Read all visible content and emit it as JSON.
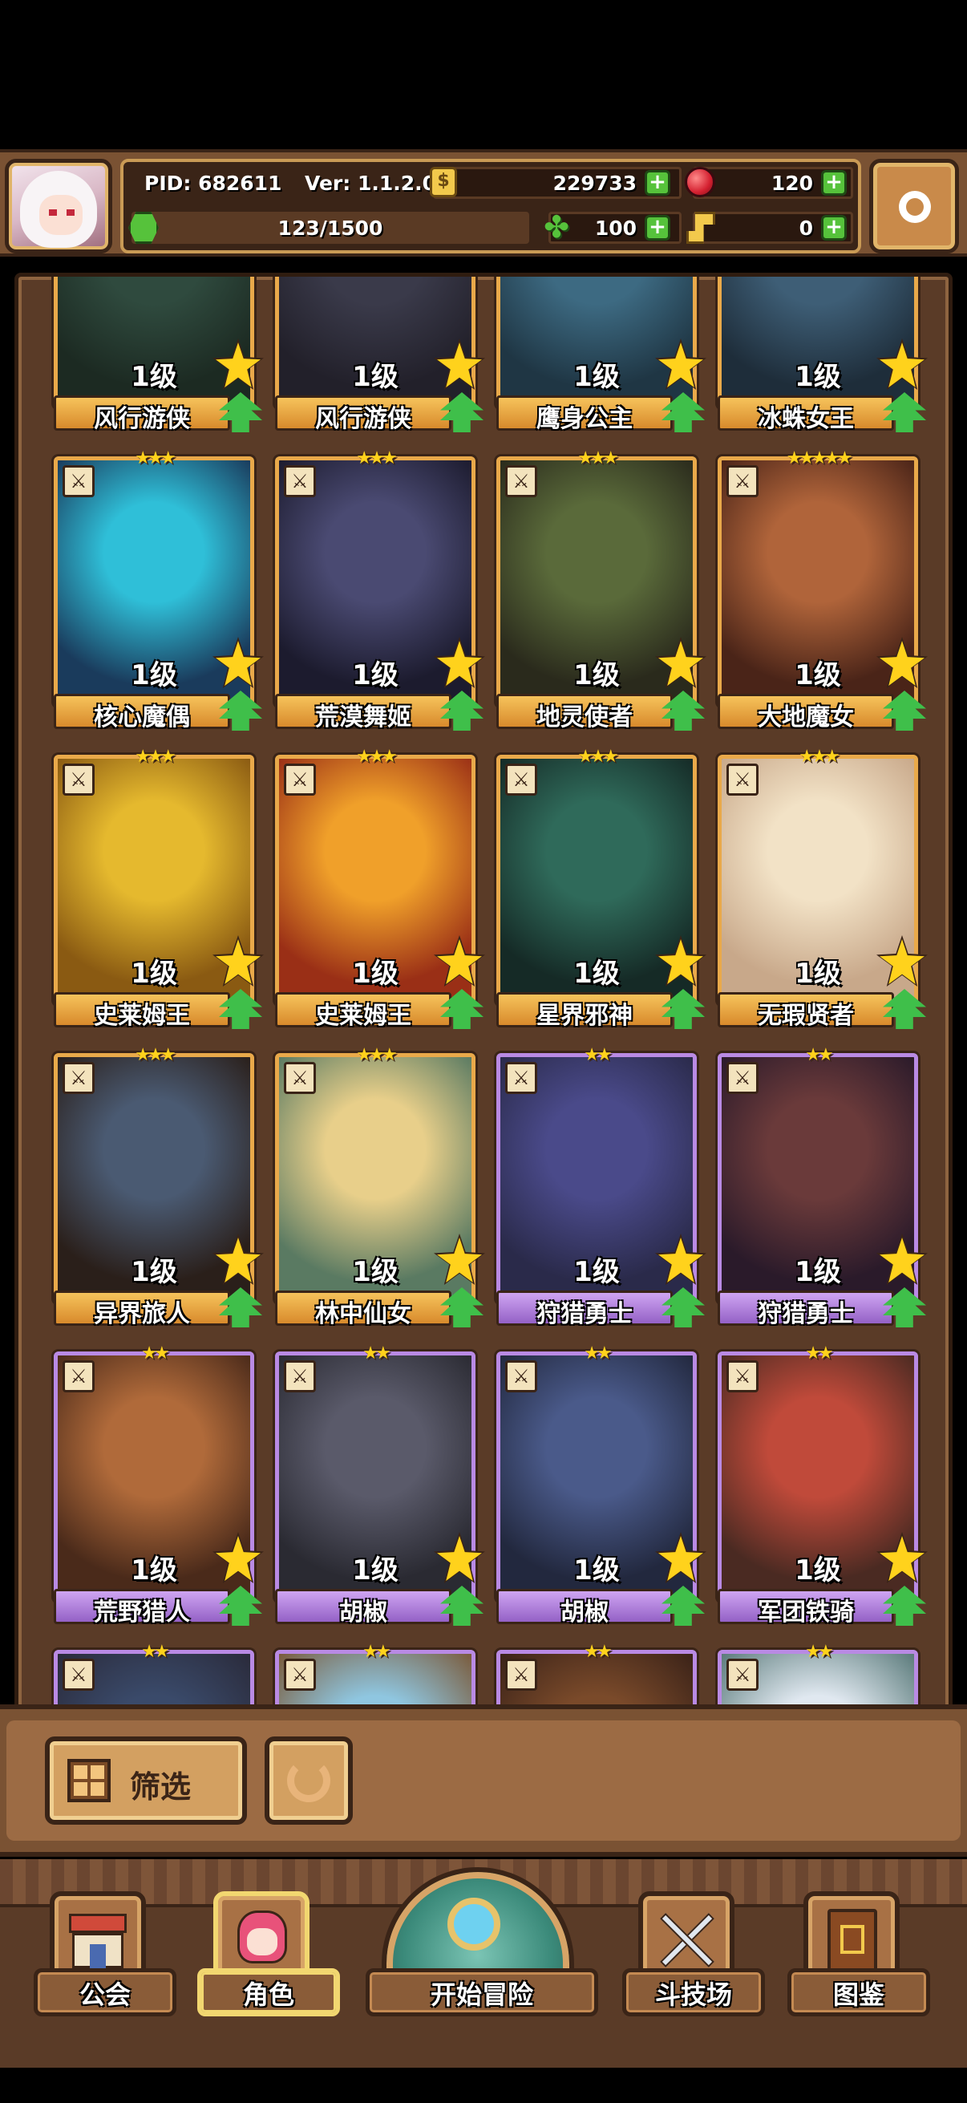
{
  "header": {
    "pid": "PID: 682611",
    "version": "Ver: 1.1.2.0",
    "gold": "229733",
    "gems": "120",
    "exp": "123/1500",
    "clover": "100",
    "keys": "0"
  },
  "roster": {
    "cards": [
      {
        "level": "1级",
        "name": "风行游侠",
        "rarity": "gold",
        "stars": "★★★",
        "art": [
          "#2f4a3e",
          "#1c2a22"
        ]
      },
      {
        "level": "1级",
        "name": "风行游侠",
        "rarity": "gold",
        "stars": "★★★",
        "art": [
          "#3a3a4a",
          "#22202a"
        ]
      },
      {
        "level": "1级",
        "name": "鹰身公主",
        "rarity": "gold",
        "stars": "★★★",
        "art": [
          "#3d6a82",
          "#1f3644"
        ]
      },
      {
        "level": "1级",
        "name": "冰蛛女王",
        "rarity": "gold",
        "stars": "★★★",
        "art": [
          "#3e5e76",
          "#1e2d3a"
        ]
      },
      {
        "level": "1级",
        "name": "核心魔偶",
        "rarity": "gold",
        "stars": "★★★",
        "art": [
          "#2fbfd8",
          "#1a3b5c"
        ]
      },
      {
        "level": "1级",
        "name": "荒漠舞姬",
        "rarity": "gold",
        "stars": "★★★",
        "art": [
          "#4a4a72",
          "#1c1b2e"
        ]
      },
      {
        "level": "1级",
        "name": "地灵使者",
        "rarity": "gold",
        "stars": "★★★",
        "art": [
          "#5a6a3a",
          "#2a2a1c"
        ]
      },
      {
        "level": "1级",
        "name": "大地魔女",
        "rarity": "gold",
        "stars": "★★★★★",
        "art": [
          "#b0643a",
          "#4a2418"
        ]
      },
      {
        "level": "1级",
        "name": "史莱姆王",
        "rarity": "gold",
        "stars": "★★★",
        "art": [
          "#e5b92e",
          "#8a5a12"
        ]
      },
      {
        "level": "1级",
        "name": "史莱姆王",
        "rarity": "gold",
        "stars": "★★★",
        "art": [
          "#f0a02a",
          "#9a2f16"
        ]
      },
      {
        "level": "1级",
        "name": "星界邪神",
        "rarity": "gold",
        "stars": "★★★",
        "art": [
          "#2f6a5a",
          "#152a26"
        ]
      },
      {
        "level": "1级",
        "name": "无瑕贤者",
        "rarity": "gold",
        "stars": "★★★",
        "art": [
          "#f2e2c6",
          "#c8a88a"
        ]
      },
      {
        "level": "1级",
        "name": "异界旅人",
        "rarity": "gold",
        "stars": "★★★",
        "art": [
          "#4a5a72",
          "#2a1f1a"
        ]
      },
      {
        "level": "1级",
        "name": "林中仙女",
        "rarity": "gold",
        "stars": "★★★",
        "art": [
          "#e8cf8a",
          "#5a7a62"
        ]
      },
      {
        "level": "1级",
        "name": "狩猎勇士",
        "rarity": "purple",
        "stars": "★★",
        "art": [
          "#4a4a8a",
          "#2a2a4a"
        ]
      },
      {
        "level": "1级",
        "name": "狩猎勇士",
        "rarity": "purple",
        "stars": "★★",
        "art": [
          "#6a3a3a",
          "#2a1a2a"
        ]
      },
      {
        "level": "1级",
        "name": "荒野猎人",
        "rarity": "purple",
        "stars": "★★",
        "art": [
          "#b06a3a",
          "#4a2a1a"
        ]
      },
      {
        "level": "1级",
        "name": "胡椒",
        "rarity": "purple",
        "stars": "★★",
        "art": [
          "#5a5a6a",
          "#2a2a32"
        ]
      },
      {
        "level": "1级",
        "name": "胡椒",
        "rarity": "purple",
        "stars": "★★",
        "art": [
          "#4a5a8a",
          "#22283e"
        ]
      },
      {
        "level": "1级",
        "name": "军团铁骑",
        "rarity": "purple",
        "stars": "★★",
        "art": [
          "#c04a3a",
          "#4a2a22"
        ]
      },
      {
        "level": "",
        "name": "",
        "rarity": "purple",
        "stars": "★★",
        "art": [
          "#3a4a6a",
          "#2a2a3a"
        ]
      },
      {
        "level": "",
        "name": "",
        "rarity": "purple",
        "stars": "★★",
        "art": [
          "#8fc6e0",
          "#7a5a3a"
        ]
      },
      {
        "level": "",
        "name": "",
        "rarity": "purple",
        "stars": "★★",
        "art": [
          "#7a4a2a",
          "#3a2218"
        ]
      },
      {
        "level": "",
        "name": "",
        "rarity": "purple",
        "stars": "★★",
        "art": [
          "#e0e8f0",
          "#5a7a7a"
        ]
      }
    ]
  },
  "toolbar": {
    "filter_label": "筛选"
  },
  "nav": {
    "guild": "公会",
    "character": "角色",
    "adventure": "开始冒险",
    "arena": "斗技场",
    "codex": "图鉴"
  },
  "colors": {
    "gold_frame": "#e9a94a",
    "purple_frame": "#b98ae4",
    "star": "#ffd21c",
    "upgrade": "#3fbf4a"
  }
}
